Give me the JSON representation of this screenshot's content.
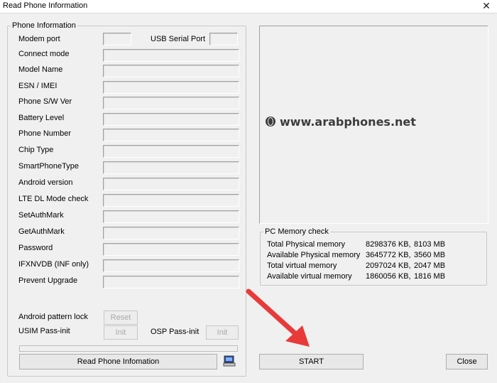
{
  "window": {
    "title": "Read Phone Information"
  },
  "phone_info": {
    "legend": "Phone Information",
    "modem_port_label": "Modem port",
    "usb_serial_label": "USB Serial Port",
    "rows": [
      {
        "label": "Connect mode"
      },
      {
        "label": "Model Name"
      },
      {
        "label": "ESN / IMEI"
      },
      {
        "label": "Phone S/W Ver"
      },
      {
        "label": "Battery Level"
      },
      {
        "label": "Phone Number"
      },
      {
        "label": "Chip Type"
      },
      {
        "label": "SmartPhoneType"
      },
      {
        "label": "Android version"
      },
      {
        "label": "LTE DL Mode check"
      },
      {
        "label": "SetAuthMark"
      },
      {
        "label": "GetAuthMark"
      },
      {
        "label": "Password"
      },
      {
        "label": "IFXNVDB (INF only)"
      },
      {
        "label": "Prevent Upgrade"
      }
    ],
    "android_pattern_label": "Android pattern lock",
    "reset_button": "Reset",
    "usim_label": "USIM Pass-init",
    "usim_init_button": "Init",
    "osp_label": "OSP Pass-init",
    "osp_init_button": "Init",
    "read_button": "Read Phone Infomation"
  },
  "watermark": "www.arabphones.net",
  "memory": {
    "legend": "PC Memory check",
    "rows": [
      {
        "label": "Total Physical memory",
        "kb": "8298376 KB,",
        "mb": "8103 MB"
      },
      {
        "label": "Available Physical memory",
        "kb": "3645772 KB,",
        "mb": "3560 MB"
      },
      {
        "label": "Total virtual memory",
        "kb": "2097024 KB,",
        "mb": "2047 MB"
      },
      {
        "label": "Available virtual memory",
        "kb": "1860056 KB,",
        "mb": "1816 MB"
      }
    ]
  },
  "actions": {
    "start_button": "START",
    "close_button": "Close"
  },
  "colors": {
    "arrow": "#e83a3a"
  },
  "icons": {
    "window_close": "close-icon",
    "computer": "computer-icon",
    "globe": "globe-icon"
  }
}
